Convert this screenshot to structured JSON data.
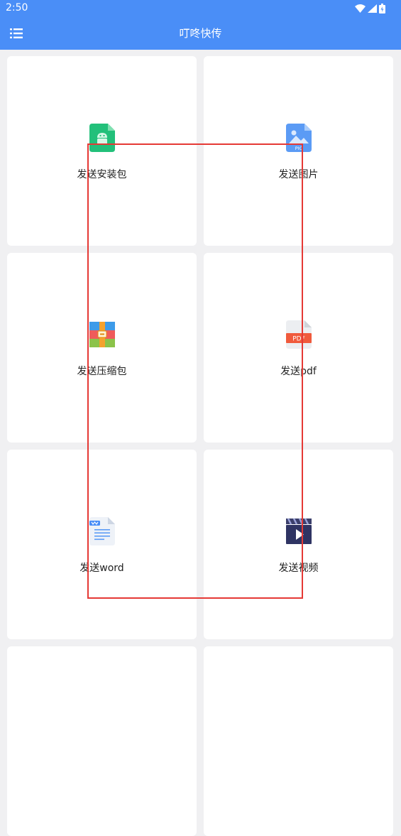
{
  "status_bar": {
    "time": "2:50",
    "icons": [
      "wifi-icon",
      "signal-icon",
      "battery-icon"
    ]
  },
  "app_bar": {
    "title": "叮咚快传",
    "menu_icon": "menu-list-icon"
  },
  "cards": [
    {
      "id": "apk",
      "label": "发送安装包",
      "icon": "android-apk-file-icon"
    },
    {
      "id": "image",
      "label": "发送图片",
      "icon": "image-file-icon",
      "icon_text": "PIC"
    },
    {
      "id": "zip",
      "label": "发送压缩包",
      "icon": "zip-archive-icon"
    },
    {
      "id": "pdf",
      "label": "发送pdf",
      "icon": "pdf-file-icon",
      "icon_text": "PDF"
    },
    {
      "id": "word",
      "label": "发送word",
      "icon": "word-document-icon"
    },
    {
      "id": "video",
      "label": "发送视频",
      "icon": "video-clapper-icon"
    },
    {
      "id": "more-left",
      "label": "",
      "icon": ""
    },
    {
      "id": "more-right",
      "label": "",
      "icon": ""
    }
  ],
  "colors": {
    "primary": "#4a8ef7",
    "background": "#f0f0f2",
    "card": "#ffffff",
    "highlight": "#e53935"
  }
}
